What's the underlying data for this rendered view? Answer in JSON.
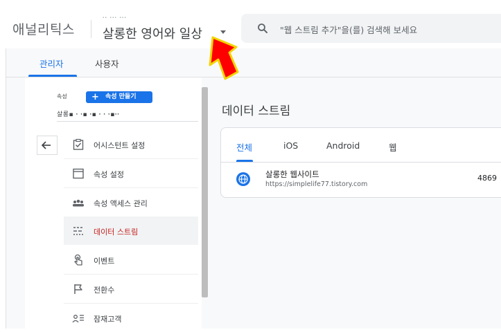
{
  "header": {
    "brand": "애널리틱스",
    "account_name": "ꞏꞏ ꞏꞏꞏ ꞏꞏꞏ",
    "property_name": "살롱한 영어와 일상",
    "search_placeholder": "\"웹 스트림 추가\"을(를) 검색해 보세요"
  },
  "tabs": [
    {
      "label": "관리자",
      "active": true
    },
    {
      "label": "사용자",
      "active": false
    }
  ],
  "property_panel": {
    "label": "속성",
    "create_button": "속성 만들기",
    "selected_property": "살롱▪ ꞏ ꞏ▪ ꞏ▪ ꞏ ꞏ ꞏ▪ꞏꞏ"
  },
  "nav_items": [
    {
      "label": "어시스턴트 설정",
      "icon": "checklist-icon",
      "active": false
    },
    {
      "label": "속성 설정",
      "icon": "window-icon",
      "active": false
    },
    {
      "label": "속성 액세스 관리",
      "icon": "people-icon",
      "active": false
    },
    {
      "label": "데이터 스트림",
      "icon": "streams-icon",
      "active": true
    },
    {
      "label": "이벤트",
      "icon": "touch-icon",
      "active": false
    },
    {
      "label": "전환수",
      "icon": "flag-icon",
      "active": false
    },
    {
      "label": "잠재고객",
      "icon": "audience-icon",
      "active": false
    }
  ],
  "main": {
    "title": "데이터 스트림",
    "stream_tabs": [
      {
        "label": "전체",
        "active": true
      },
      {
        "label": "iOS",
        "active": false
      },
      {
        "label": "Android",
        "active": false
      },
      {
        "label": "웹",
        "active": false
      }
    ],
    "streams": [
      {
        "name": "살롱한 웹사이트",
        "url": "https://simplelife77.tistory.com",
        "id": "4869"
      }
    ]
  },
  "colors": {
    "accent": "#1a73e8",
    "active_nav": "#c5221f",
    "arrow": "#ff0000"
  }
}
